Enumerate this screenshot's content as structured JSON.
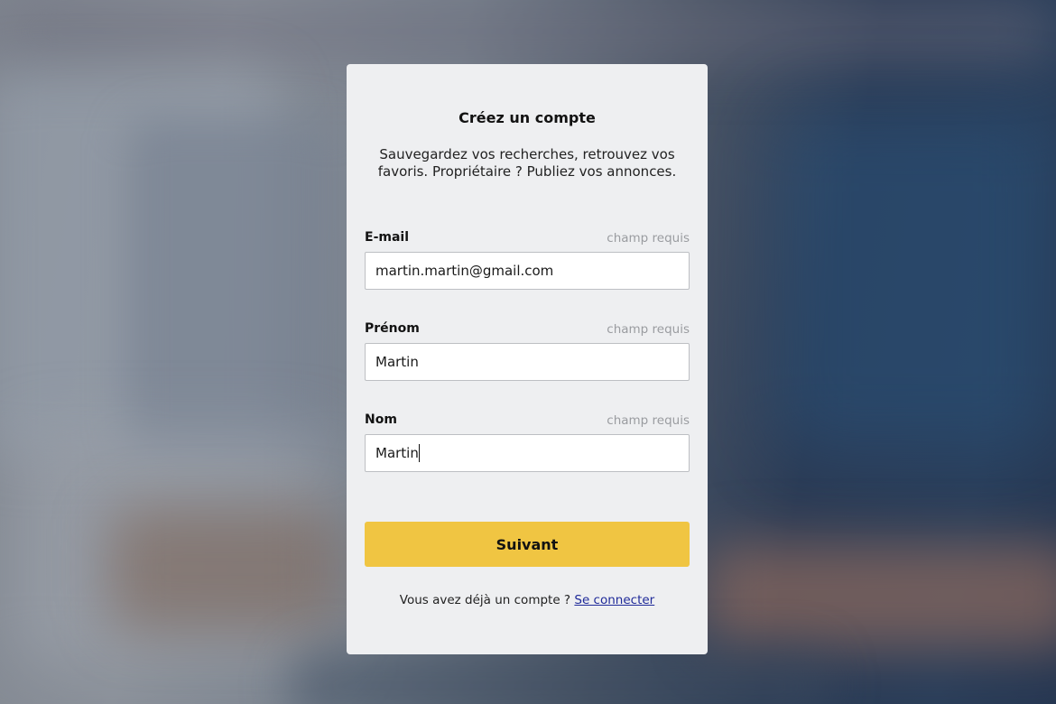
{
  "form": {
    "title": "Créez un compte",
    "subtitle": "Sauvegardez vos recherches, retrouvez vos favoris. Propriétaire ? Publiez vos annonces.",
    "required_text": "champ requis",
    "fields": [
      {
        "label": "E-mail",
        "value": "martin.martin@gmail.com"
      },
      {
        "label": "Prénom",
        "value": "Martin"
      },
      {
        "label": "Nom",
        "value": "Martin"
      }
    ],
    "submit_label": "Suivant",
    "footer_text": "Vous avez déjà un compte ?",
    "footer_link": "Se connecter"
  },
  "colors": {
    "card_bg": "#eeeff1",
    "button_bg": "#f0c542",
    "link": "#1f2a99",
    "muted": "#9a9ca0"
  }
}
